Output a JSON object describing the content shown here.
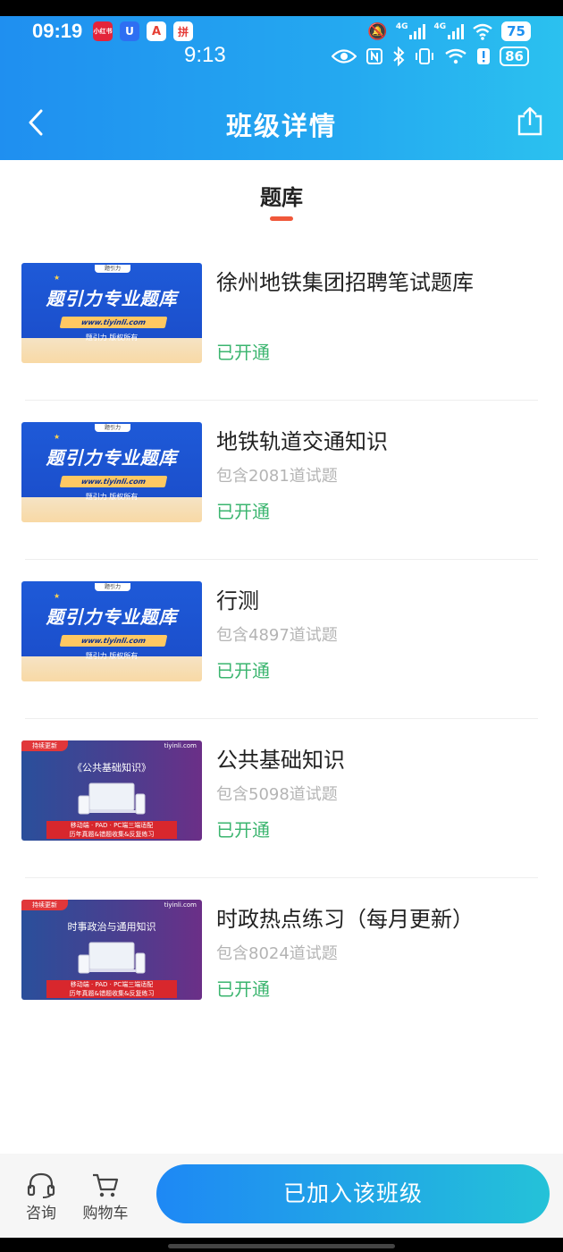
{
  "status_bar": {
    "time": "09:19",
    "apps": [
      {
        "label": "小红书",
        "color": "#e3243b"
      },
      {
        "label": "U",
        "color": "#2e6ff2"
      },
      {
        "label": "A",
        "color": "#e63f33"
      },
      {
        "label": "拼",
        "color": "#e53935"
      }
    ],
    "signal_labels": [
      "4G",
      "4G"
    ],
    "battery": "75"
  },
  "inner_status_bar": {
    "time": "9:13",
    "battery": "86"
  },
  "nav": {
    "title": "班级详情"
  },
  "section": {
    "title": "题库"
  },
  "thumb_text": {
    "blue_main": "题引力专业题库",
    "blue_url": "www.tiyinli.com",
    "blue_copy": "题引力 版权所有",
    "blue_logo": "题引力",
    "purple_tag": "持续更新",
    "purple_brand": "tiyinli.com",
    "purple_heading_1": "《公共基础知识》",
    "purple_heading_2": "时事政治与通用知识",
    "purple_banner_1": "移动端 · PAD · PC端三端适配",
    "purple_banner_2": "历年真题&错题收集&反复练习"
  },
  "items": [
    {
      "title": "徐州地铁集团招聘笔试题库",
      "count": "",
      "status": "已开通",
      "thumb": "blue"
    },
    {
      "title": "地铁轨道交通知识",
      "count": "包含2081道试题",
      "status": "已开通",
      "thumb": "blue"
    },
    {
      "title": "行测",
      "count": "包含4897道试题",
      "status": "已开通",
      "thumb": "blue"
    },
    {
      "title": "公共基础知识",
      "count": "包含5098道试题",
      "status": "已开通",
      "thumb": "purple"
    },
    {
      "title": "时政热点练习（每月更新）",
      "count": "包含8024道试题",
      "status": "已开通",
      "thumb": "purple"
    }
  ],
  "bottom_bar": {
    "consult_label": "咨询",
    "cart_label": "购物车",
    "join_label": "已加入该班级"
  },
  "colors": {
    "header_start": "#1f8ff0",
    "header_end": "#2bc1ef",
    "status_open": "#3bb56f",
    "tab_underline": "#f0583a"
  }
}
